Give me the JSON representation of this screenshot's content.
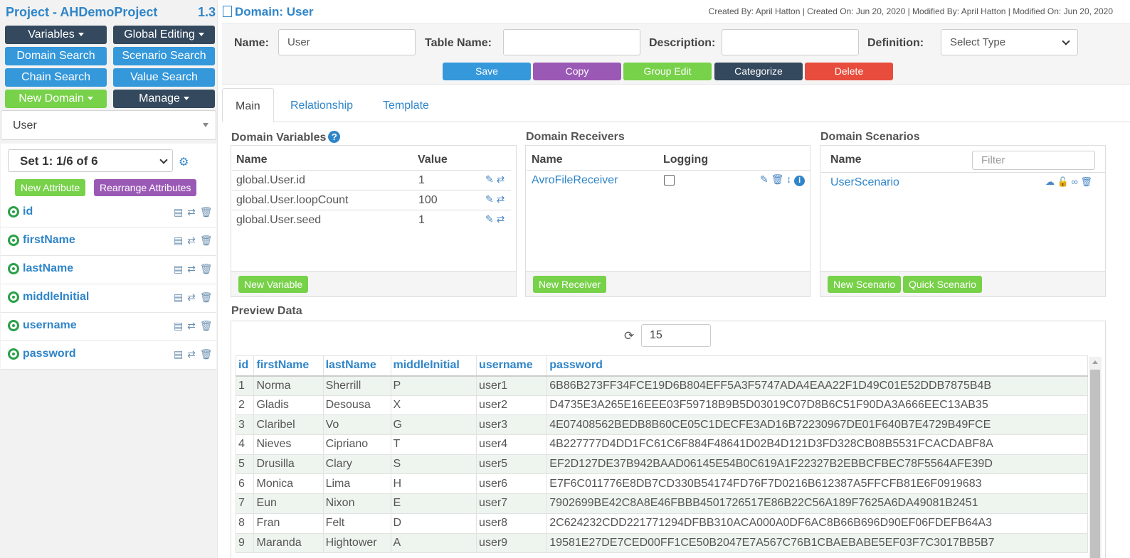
{
  "project": {
    "title": "Project - AHDemoProject",
    "version": "1.3"
  },
  "sidebar": {
    "buttons": {
      "variables": "Variables",
      "global_editing": "Global Editing",
      "domain_search": "Domain Search",
      "scenario_search": "Scenario Search",
      "chain_search": "Chain Search",
      "value_search": "Value Search",
      "new_domain": "New Domain",
      "manage": "Manage"
    },
    "domain_select": "User",
    "set_select": "Set 1: 1/6 of 6",
    "new_attribute": "New Attribute",
    "rearrange_attributes": "Rearrange Attributes",
    "attributes": [
      "id",
      "firstName",
      "lastName",
      "middleInitial",
      "username",
      "password"
    ]
  },
  "header": {
    "domain_title": "Domain: User",
    "meta": "Created By: April Hatton | Created On: Jun 20, 2020 | Modified By: April Hatton | Modified On: Jun 20, 2020"
  },
  "form": {
    "name_label": "Name:",
    "name_value": "User",
    "table_name_label": "Table Name:",
    "table_name_value": "",
    "description_label": "Description:",
    "description_value": "",
    "definition_label": "Definition:",
    "definition_value": "Select Type"
  },
  "actions": {
    "save": "Save",
    "copy": "Copy",
    "group_edit": "Group Edit",
    "categorize": "Categorize",
    "delete": "Delete"
  },
  "colors": {
    "primary": "#3498db",
    "dark": "#34495e",
    "green": "#77d149",
    "purple": "#9b59b6",
    "red": "#e74c3c",
    "link": "#2f85c9"
  },
  "tabs": [
    "Main",
    "Relationship",
    "Template"
  ],
  "domain_variables": {
    "title": "Domain Variables",
    "col_name": "Name",
    "col_value": "Value",
    "rows": [
      {
        "name": "global.User.id",
        "value": "1"
      },
      {
        "name": "global.User.loopCount",
        "value": "100"
      },
      {
        "name": "global.User.seed",
        "value": "1"
      }
    ],
    "new_button": "New Variable"
  },
  "domain_receivers": {
    "title": "Domain Receivers",
    "col_name": "Name",
    "col_logging": "Logging",
    "rows": [
      {
        "name": "AvroFileReceiver"
      }
    ],
    "new_button": "New Receiver"
  },
  "domain_scenarios": {
    "title": "Domain Scenarios",
    "col_name": "Name",
    "filter_placeholder": "Filter",
    "rows": [
      {
        "name": "UserScenario"
      }
    ],
    "new_button": "New Scenario",
    "quick_button": "Quick Scenario"
  },
  "preview": {
    "title": "Preview Data",
    "count": "15",
    "columns": [
      "id",
      "firstName",
      "lastName",
      "middleInitial",
      "username",
      "password"
    ],
    "rows": [
      [
        "1",
        "Norma",
        "Sherrill",
        "P",
        "user1",
        "6B86B273FF34FCE19D6B804EFF5A3F5747ADA4EAA22F1D49C01E52DDB7875B4B"
      ],
      [
        "2",
        "Gladis",
        "Desousa",
        "X",
        "user2",
        "D4735E3A265E16EEE03F59718B9B5D03019C07D8B6C51F90DA3A666EEC13AB35"
      ],
      [
        "3",
        "Claribel",
        "Vo",
        "G",
        "user3",
        "4E07408562BEDB8B60CE05C1DECFE3AD16B72230967DE01F640B7E4729B49FCE"
      ],
      [
        "4",
        "Nieves",
        "Cipriano",
        "T",
        "user4",
        "4B227777D4DD1FC61C6F884F48641D02B4D121D3FD328CB08B5531FCACDABF8A"
      ],
      [
        "5",
        "Drusilla",
        "Clary",
        "S",
        "user5",
        "EF2D127DE37B942BAAD06145E54B0C619A1F22327B2EBBCFBEC78F5564AFE39D"
      ],
      [
        "6",
        "Monica",
        "Lima",
        "H",
        "user6",
        "E7F6C011776E8DB7CD330B54174FD76F7D0216B612387A5FFCFB81E6F0919683"
      ],
      [
        "7",
        "Eun",
        "Nixon",
        "E",
        "user7",
        "7902699BE42C8A8E46FBBB4501726517E86B22C56A189F7625A6DA49081B2451"
      ],
      [
        "8",
        "Fran",
        "Felt",
        "D",
        "user8",
        "2C624232CDD221771294DFBB310ACA000A0DF6AC8B66B696D90EF06FDEFB64A3"
      ],
      [
        "9",
        "Maranda",
        "Hightower",
        "A",
        "user9",
        "19581E27DE7CED00FF1CE50B2047E7A567C76B1CBAEBABE5EF03F7C3017BB5B7"
      ]
    ]
  }
}
